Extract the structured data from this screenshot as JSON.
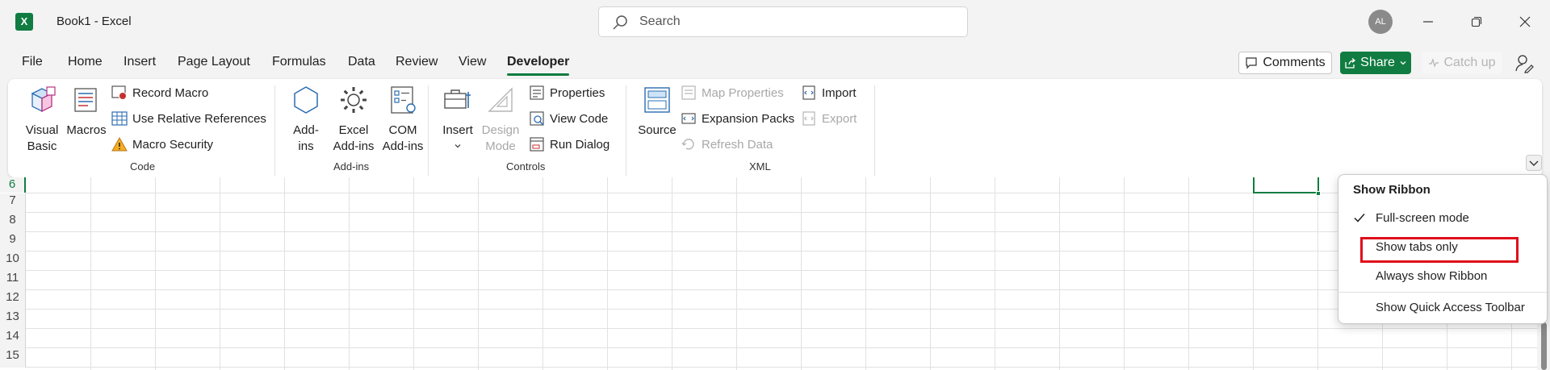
{
  "titlebar": {
    "app_logo": "X",
    "doc_title": "Book1  -  Excel",
    "search_placeholder": "Search",
    "avatar_initials": "AL"
  },
  "tabs": [
    "File",
    "Home",
    "Insert",
    "Page Layout",
    "Formulas",
    "Data",
    "Review",
    "View",
    "Developer"
  ],
  "active_tab": "Developer",
  "actions": {
    "comments": "Comments",
    "share": "Share",
    "catch_up": "Catch up"
  },
  "ribbon": {
    "code": {
      "label": "Code",
      "visual_basic_1": "Visual",
      "visual_basic_2": "Basic",
      "macros": "Macros",
      "record_macro": "Record Macro",
      "use_relative_references": "Use Relative References",
      "macro_security": "Macro Security"
    },
    "addins": {
      "label": "Add-ins",
      "addins_1": "Add-",
      "addins_2": "ins",
      "excel_addins_1": "Excel",
      "excel_addins_2": "Add-ins",
      "com_addins_1": "COM",
      "com_addins_2": "Add-ins"
    },
    "controls": {
      "label": "Controls",
      "insert": "Insert",
      "design_mode_1": "Design",
      "design_mode_2": "Mode",
      "properties": "Properties",
      "view_code": "View Code",
      "run_dialog": "Run Dialog"
    },
    "xml": {
      "label": "XML",
      "source": "Source",
      "map_properties": "Map Properties",
      "expansion_packs": "Expansion Packs",
      "refresh_data": "Refresh Data",
      "import": "Import",
      "export": "Export"
    }
  },
  "grid": {
    "rows": [
      "6",
      "7",
      "8",
      "9",
      "10",
      "11",
      "12",
      "13",
      "14",
      "15"
    ]
  },
  "menu": {
    "title": "Show Ribbon",
    "items": [
      "Full-screen mode",
      "Show tabs only",
      "Always show Ribbon",
      "Show Quick Access Toolbar"
    ],
    "checked": "Full-screen mode",
    "highlighted": "Show tabs only"
  },
  "colors": {
    "accent": "#107c41",
    "highlight": "#e00d1a"
  }
}
